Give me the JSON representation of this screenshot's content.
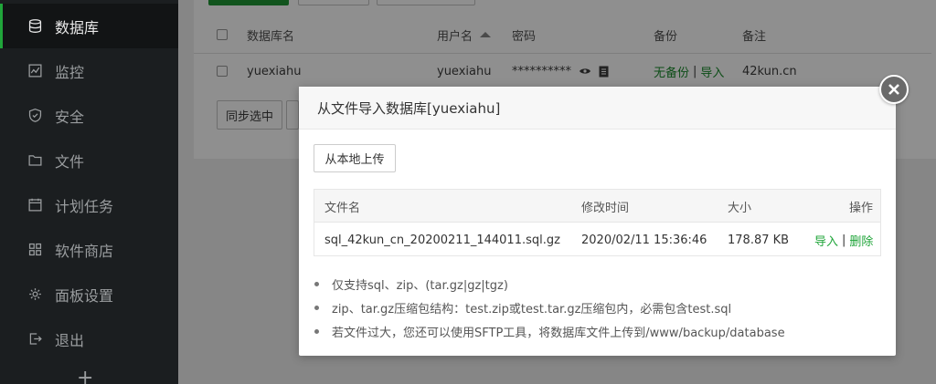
{
  "sidebar": {
    "items": [
      {
        "label": "数据库",
        "icon": "database-icon",
        "active": true
      },
      {
        "label": "监控",
        "icon": "monitor-icon"
      },
      {
        "label": "安全",
        "icon": "shield-icon"
      },
      {
        "label": "文件",
        "icon": "folder-icon"
      },
      {
        "label": "计划任务",
        "icon": "calendar-icon"
      },
      {
        "label": "软件商店",
        "icon": "grid-icon"
      },
      {
        "label": "面板设置",
        "icon": "gear-icon"
      },
      {
        "label": "退出",
        "icon": "logout-icon"
      }
    ],
    "add_label": "+"
  },
  "db_table": {
    "headers": {
      "name": "数据库名",
      "user": "用户名",
      "password": "密码",
      "backup": "备份",
      "note": "备注"
    },
    "row": {
      "name": "yuexiahu",
      "user": "yuexiahu",
      "password": "**********",
      "backup_status": "无备份",
      "backup_sep": "|",
      "import_label": "导入",
      "note": "42kun.cn"
    },
    "sync_button": "同步选中"
  },
  "modal": {
    "title": "从文件导入数据库[yuexiahu]",
    "upload_button": "从本地上传",
    "file_table": {
      "headers": {
        "filename": "文件名",
        "mtime": "修改时间",
        "size": "大小",
        "actions": "操作"
      },
      "rows": [
        {
          "filename": "sql_42kun_cn_20200211_144011.sql.gz",
          "mtime": "2020/02/11 15:36:46",
          "size": "178.87 KB",
          "import": "导入",
          "sep": "|",
          "delete": "删除"
        }
      ]
    },
    "notes": [
      "仅支持sql、zip、(tar.gz|gz|tgz)",
      "zip、tar.gz压缩包结构：test.zip或test.tar.gz压缩包内，必需包含test.sql",
      "若文件过大，您还可以使用SFTP工具，将数据库文件上传到/www/backup/database"
    ]
  },
  "colors": {
    "accent": "#20a53a",
    "sidebar_bg": "#1b1e20",
    "overlay": "#8c8c8c"
  }
}
